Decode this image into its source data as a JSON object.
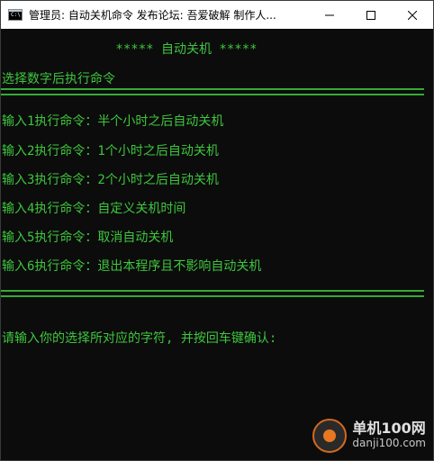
{
  "window": {
    "title": "管理员:  自动关机命令   发布论坛:  吾爱破解     制作人...",
    "icon_label": "C:\\",
    "controls": {
      "minimize": "minimize-icon",
      "maximize": "maximize-icon",
      "close": "close-icon"
    }
  },
  "console": {
    "heading": "               ***** 自动关机 *****",
    "prompt": "选择数字后执行命令",
    "rule": "================================================================",
    "options": [
      "输入1执行命令：半个小时之后自动关机",
      "输入2执行命令：1个小时之后自动关机",
      "输入3执行命令：2个小时之后自动关机",
      "输入4执行命令：自定义关机时间",
      "输入5执行命令：取消自动关机",
      "输入6执行命令：退出本程序且不影响自动关机"
    ],
    "input_prompt": "请输入你的选择所对应的字符, 并按回车键确认:",
    "text_color": "#3ec63e",
    "background": "#0c0c0c"
  },
  "watermark": {
    "title": "单机100网",
    "url": "danji100.com"
  }
}
